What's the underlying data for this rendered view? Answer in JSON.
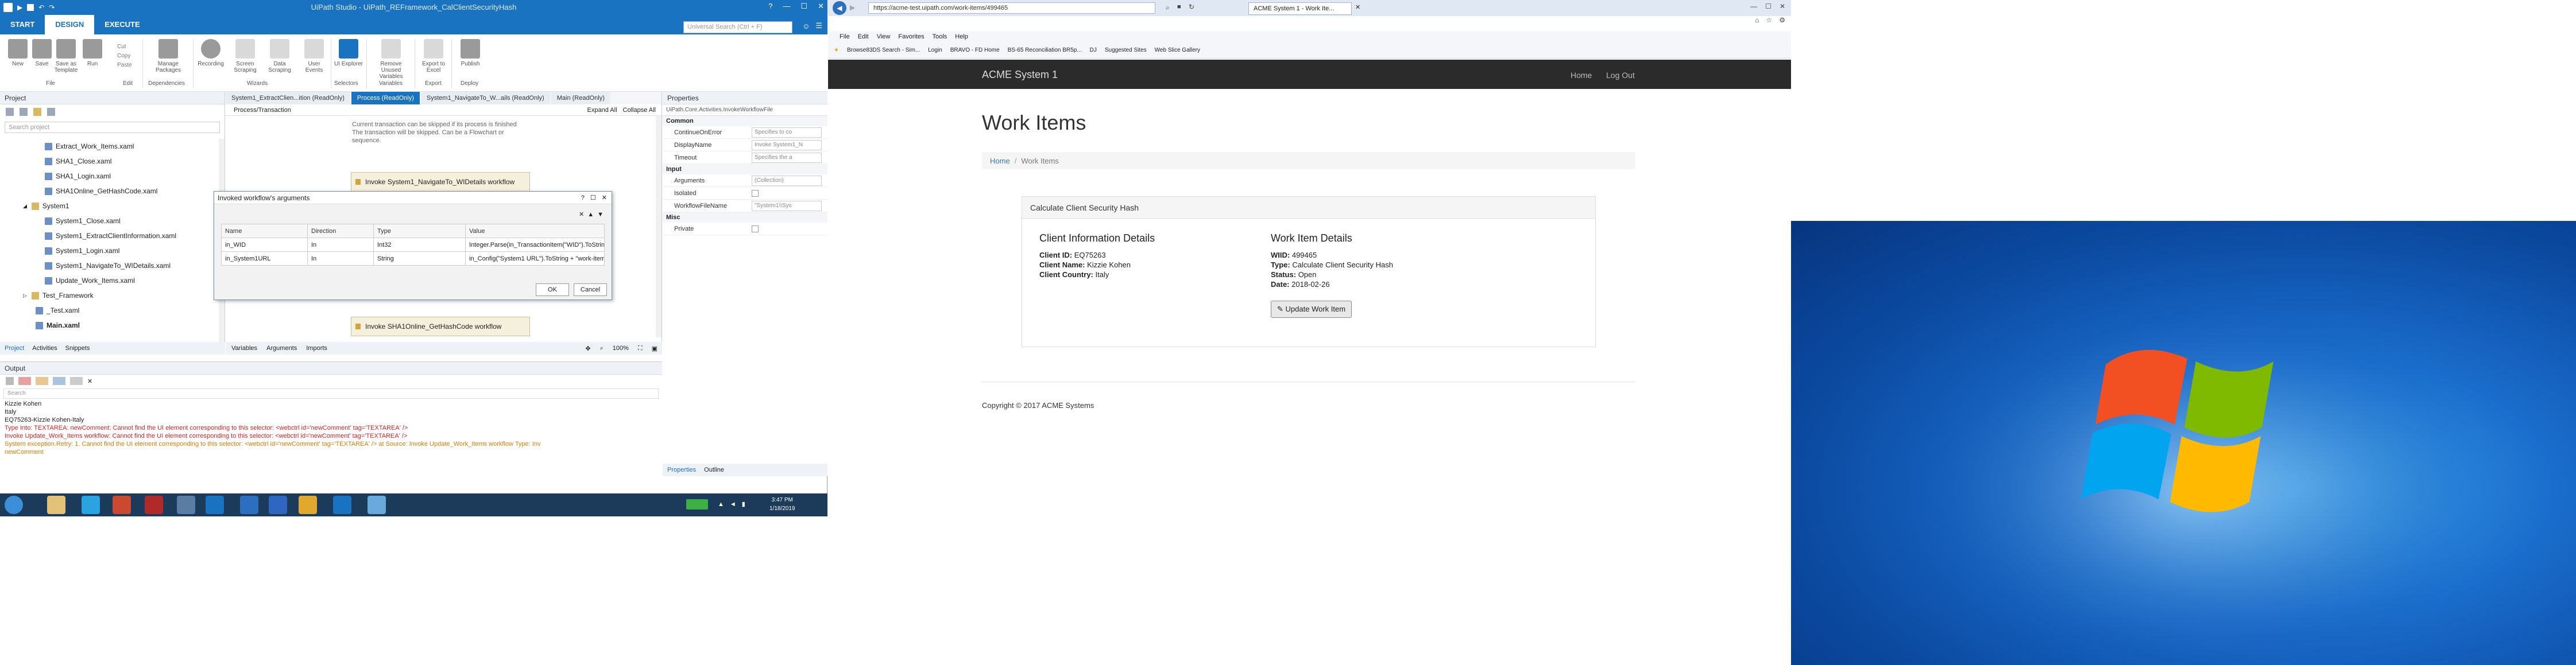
{
  "studio": {
    "title": "UiPath Studio - UiPath_REFramework_CalClientSecurityHash",
    "tabs": [
      "START",
      "DESIGN",
      "EXECUTE"
    ],
    "search_placeholder": "Universal Search (Ctrl + F)",
    "ribbon": {
      "file": [
        "New",
        "Save",
        "Save as Template",
        "Run"
      ],
      "edit": [
        "Cut",
        "Copy",
        "Paste"
      ],
      "dependencies": "Manage Packages",
      "wizards": [
        "Recording",
        "Screen Scraping",
        "Data Scraping",
        "User Events"
      ],
      "selectors": "UI Explorer",
      "variables": "Remove Unused Variables",
      "export": "Export to Excel",
      "deploy": "Publish",
      "groups": [
        "File",
        "Edit",
        "Dependencies",
        "Wizards",
        "Selectors",
        "Variables",
        "Export",
        "Deploy"
      ]
    },
    "project": {
      "header": "Project",
      "search_placeholder": "Search project",
      "items": [
        "Extract_Work_Items.xaml",
        "SHA1_Close.xaml",
        "SHA1_Login.xaml",
        "SHA1Online_GetHashCode.xaml",
        "System1",
        "System1_Close.xaml",
        "System1_ExtractClientInformation.xaml",
        "System1_Login.xaml",
        "System1_NavigateTo_WIDetails.xaml",
        "Update_Work_Items.xaml",
        "Test_Framework",
        "_Test.xaml",
        "Main.xaml"
      ],
      "bottom_tabs": [
        "Project",
        "Activities",
        "Snippets"
      ]
    },
    "designer": {
      "tabs": [
        "System1_ExtractClien...ition (ReadOnly)",
        "Process (ReadOnly)",
        "System1_NavigateTo_W...ails (ReadOnly)",
        "Main (ReadOnly)"
      ],
      "breadcrumb": "Process/Transaction",
      "expand_all": "Expand All",
      "collapse_all": "Collapse All",
      "hint": "The transaction will be skipped. Can be a Flowchart or sequence.",
      "hint2": "Current transaction can be skipped if its process is finished",
      "activity1": "Invoke System1_NavigateTo_WIDetails workflow",
      "activity2": "Invoke SHA1Online_GetHashCode workflow",
      "bottom_tabs": [
        "Variables",
        "Arguments",
        "Imports"
      ],
      "zoom": "100%"
    },
    "dialog": {
      "title": "Invoked workflow's arguments",
      "columns": [
        "Name",
        "Direction",
        "Type",
        "Value"
      ],
      "rows": [
        [
          "in_WID",
          "In",
          "Int32",
          "Integer.Parse(in_TransactionItem(\"WID\").ToString)"
        ],
        [
          "in_System1URL",
          "In",
          "String",
          "in_Config(\"System1 URL\").ToString + \"work-items/\""
        ]
      ],
      "ok": "OK",
      "cancel": "Cancel"
    },
    "properties": {
      "header": "Properties",
      "class": "UiPath.Core.Activities.InvokeWorkflowFile",
      "common_label": "Common",
      "common": [
        {
          "k": "ContinueOnError",
          "v": "Specifies to co"
        },
        {
          "k": "DisplayName",
          "v": "Invoke System1_N"
        },
        {
          "k": "Timeout",
          "v": "Specifies the a"
        }
      ],
      "input_label": "Input",
      "input": [
        {
          "k": "Arguments",
          "v": "(Collection)"
        },
        {
          "k": "Isolated",
          "v": ""
        },
        {
          "k": "WorkflowFileName",
          "v": "\"System1\\\\Sys"
        }
      ],
      "misc_label": "Misc",
      "misc": [
        {
          "k": "Private",
          "v": ""
        }
      ],
      "bottom_tabs": [
        "Properties",
        "Outline"
      ]
    },
    "output": {
      "header": "Output",
      "search_placeholder": "Search",
      "lines": [
        {
          "t": "Kizzie Kohen",
          "k": "n"
        },
        {
          "t": "Italy",
          "k": "n"
        },
        {
          "t": "EQ75263-Kizzie Kohen-Italy",
          "k": "n"
        },
        {
          "t": "Type Into: TEXTAREA: newComment: Cannot find the UI element corresponding to this selector: <webctrl id='newComment' tag='TEXTAREA' />",
          "k": "err"
        },
        {
          "t": "Invoke Update_Work_Items workflow: Cannot find the UI element corresponding to this selector: <webctrl id='newComment' tag='TEXTAREA' />",
          "k": "err"
        },
        {
          "t": "System exception.Retry: 1. Cannot find the UI element corresponding to this selector: <webctrl id='newComment' tag='TEXTAREA' /> at Source: Invoke Update_Work_Items workflow Type: Inv",
          "k": "warn"
        },
        {
          "t": "newComment",
          "k": "warn"
        }
      ]
    },
    "clock": {
      "time": "3:47 PM",
      "date": "1/18/2019"
    }
  },
  "ie": {
    "url": "https://acme-test.uipath.com/work-items/499465",
    "tab": "ACME System 1 - Work Ite...",
    "menu": [
      "File",
      "Edit",
      "View",
      "Favorites",
      "Tools",
      "Help"
    ],
    "favorites": [
      "Browse83DS Search - Sim...",
      "Login",
      "BRAVO - FD Home",
      "BS-65 Reconciliation BR5p...",
      "DJ",
      "Suggested Sites",
      "Web Slice Gallery"
    ]
  },
  "acme": {
    "brand": "ACME System 1",
    "nav": [
      "Home",
      "Log Out"
    ],
    "heading": "Work Items",
    "breadcrumb": [
      "Home",
      "Work Items"
    ],
    "panel_title": "Calculate Client Security Hash",
    "client_title": "Client Information Details",
    "client": [
      {
        "k": "Client ID:",
        "v": "EQ75263"
      },
      {
        "k": "Client Name:",
        "v": "Kizzie Kohen"
      },
      {
        "k": "Client Country:",
        "v": "Italy"
      }
    ],
    "wi_title": "Work Item Details",
    "wi": [
      {
        "k": "WIID:",
        "v": "499465"
      },
      {
        "k": "Type:",
        "v": "Calculate Client Security Hash"
      },
      {
        "k": "Status:",
        "v": "Open"
      },
      {
        "k": "Date:",
        "v": "2018-02-26"
      }
    ],
    "update_button": "Update Work Item",
    "footer": "Copyright © 2017 ACME Systems"
  },
  "colors": {
    "uipath_blue": "#1a73c1",
    "acme_nav": "#2b2b2b",
    "error": "#dd2222",
    "warn": "#e07b00"
  }
}
